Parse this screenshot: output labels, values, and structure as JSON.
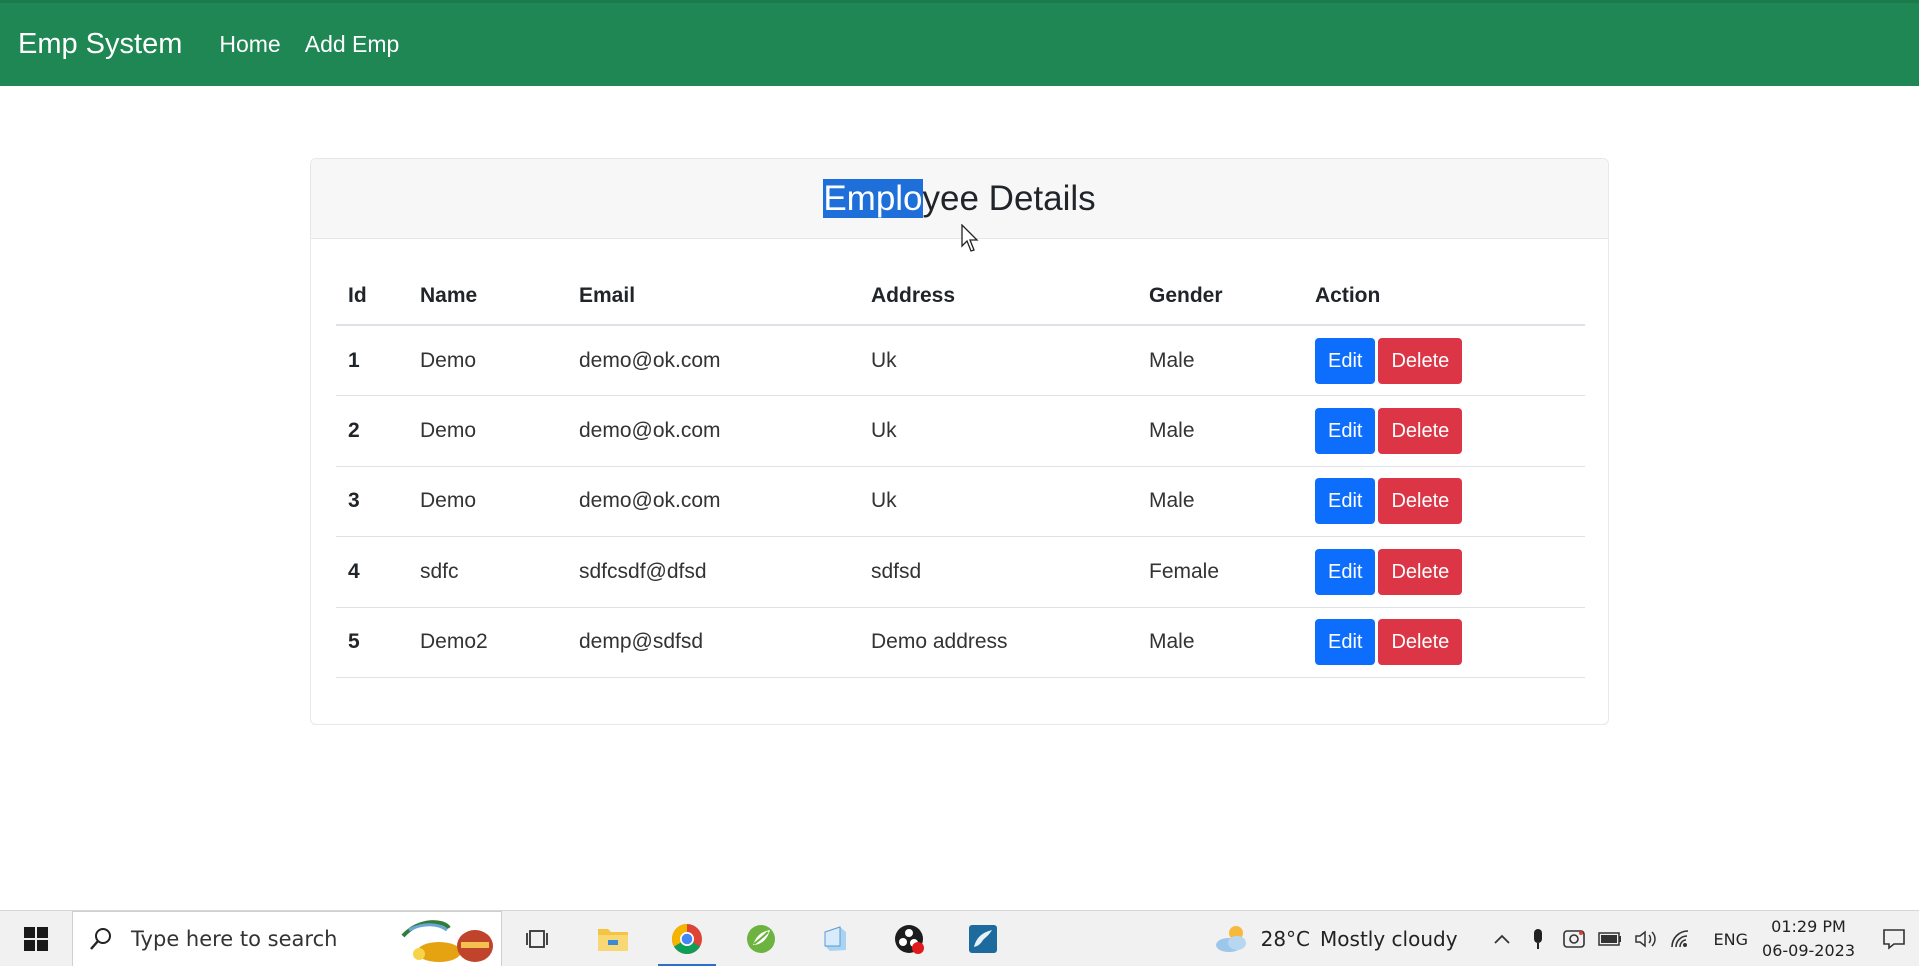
{
  "navbar": {
    "brand": "Emp System",
    "links": [
      "Home",
      "Add Emp"
    ],
    "color": "#1e8754"
  },
  "card": {
    "title_selected": "Emplo",
    "title_rest": "yee Details"
  },
  "table": {
    "headers": [
      "Id",
      "Name",
      "Email",
      "Address",
      "Gender",
      "Action"
    ],
    "rows": [
      {
        "id": "1",
        "name": "Demo",
        "email": "demo@ok.com",
        "address": "Uk",
        "gender": "Male"
      },
      {
        "id": "2",
        "name": "Demo",
        "email": "demo@ok.com",
        "address": "Uk",
        "gender": "Male"
      },
      {
        "id": "3",
        "name": "Demo",
        "email": "demo@ok.com",
        "address": "Uk",
        "gender": "Male"
      },
      {
        "id": "4",
        "name": "sdfc",
        "email": "sdfcsdf@dfsd",
        "address": "sdfsd",
        "gender": "Female"
      },
      {
        "id": "5",
        "name": "Demo2",
        "email": "demp@sdfsd",
        "address": "Demo address",
        "gender": "Male"
      }
    ],
    "edit_label": "Edit",
    "delete_label": "Delete",
    "edit_color": "#0d6efd",
    "delete_color": "#dc3545"
  },
  "taskbar": {
    "search_placeholder": "Type here to search",
    "apps": [
      "task-view-icon",
      "file-explorer-icon",
      "chrome-icon",
      "spring-tool-suite-icon",
      "notepad-icon",
      "obs-icon",
      "mysql-workbench-icon"
    ],
    "weather_temp": "28°C",
    "weather_desc": "Mostly cloudy",
    "language": "ENG",
    "time": "01:29 PM",
    "date": "06-09-2023"
  }
}
